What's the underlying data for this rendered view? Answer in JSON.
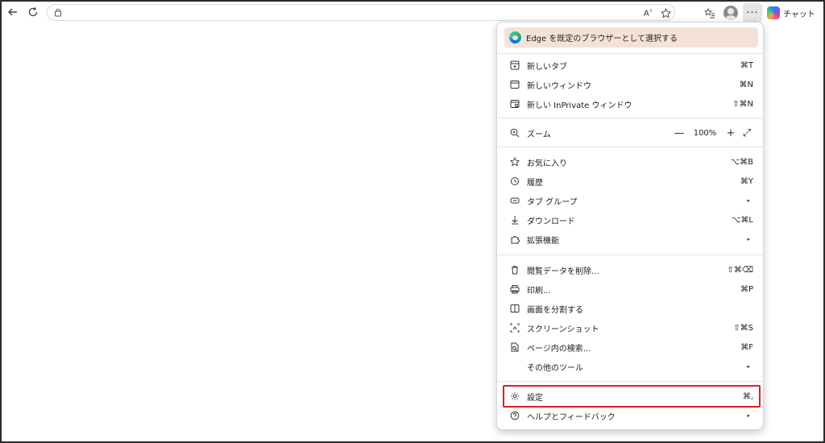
{
  "toolbar": {
    "back_icon": "back-arrow-icon",
    "refresh_icon": "refresh-icon",
    "chat_label": "チャット"
  },
  "menu": {
    "promo": "Edge を既定のブラウザーとして選択する",
    "group1": [
      {
        "label": "新しいタブ",
        "shortcut": "⌘T",
        "icon": "new-tab-icon"
      },
      {
        "label": "新しいウィンドウ",
        "shortcut": "⌘N",
        "icon": "new-window-icon"
      },
      {
        "label": "新しい InPrivate ウィンドウ",
        "shortcut": "⇧⌘N",
        "icon": "inprivate-window-icon"
      }
    ],
    "zoom": {
      "label": "ズーム",
      "minus": "—",
      "value": "100%",
      "plus": "+",
      "fullscreen": "⤢"
    },
    "group3": [
      {
        "label": "お気に入り",
        "shortcut": "⌥⌘B",
        "icon": "favorites-icon"
      },
      {
        "label": "履歴",
        "shortcut": "⌘Y",
        "icon": "history-icon"
      },
      {
        "label": "タブ グループ",
        "shortcut": "▸",
        "icon": "tab-groups-icon"
      },
      {
        "label": "ダウンロード",
        "shortcut": "⌥⌘L",
        "icon": "download-icon"
      },
      {
        "label": "拡張機能",
        "shortcut": "▸",
        "icon": "extensions-icon"
      }
    ],
    "group4": [
      {
        "label": "閲覧データを削除...",
        "shortcut": "⇧⌘⌫",
        "icon": "delete-data-icon"
      },
      {
        "label": "印刷...",
        "shortcut": "⌘P",
        "icon": "print-icon"
      },
      {
        "label": "画面を分割する",
        "shortcut": "",
        "icon": "split-screen-icon"
      },
      {
        "label": "スクリーンショット",
        "shortcut": "⇧⌘S",
        "icon": "screenshot-icon"
      },
      {
        "label": "ページ内の検索...",
        "shortcut": "⌘F",
        "icon": "find-in-page-icon"
      },
      {
        "label": "その他のツール",
        "shortcut": "▸",
        "icon": ""
      }
    ],
    "group5": [
      {
        "label": "設定",
        "shortcut": "⌘,",
        "icon": "settings-icon"
      },
      {
        "label": "ヘルプとフィードバック",
        "shortcut": "▸",
        "icon": "help-icon"
      }
    ]
  },
  "colors": {
    "promo_bg": "#f4e2d6",
    "highlight_border": "#e51b23",
    "arrow": "#e8060b"
  }
}
